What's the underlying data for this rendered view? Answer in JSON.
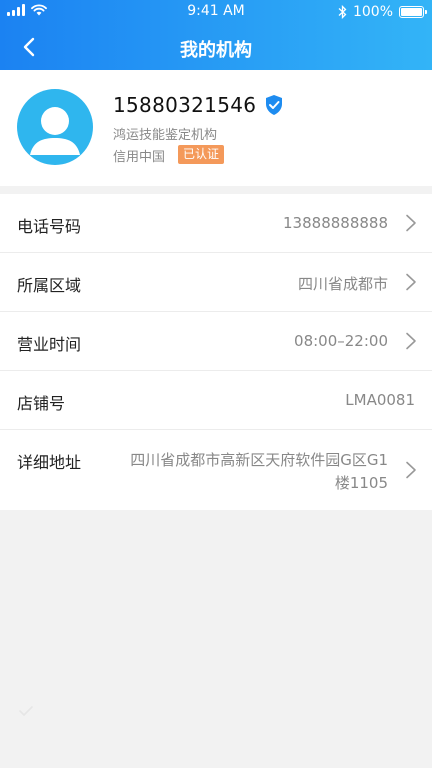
{
  "status_bar": {
    "time": "9:41 AM",
    "battery": "100%",
    "battery_level": 1.0
  },
  "nav": {
    "title": "我的机构",
    "back_icon": "chevron-left-icon"
  },
  "profile": {
    "phone": "15880321546",
    "org_name": "鸿运技能鉴定机构",
    "credit_label": "信用中国",
    "cert_badge": "已认证",
    "avatar_icon": "user-avatar-icon",
    "verify_icon": "shield-check-icon"
  },
  "info": {
    "phone_label": "电话号码",
    "phone_value": "13888888888",
    "region_label": "所属区域",
    "region_value": "四川省成都市",
    "hours_label": "营业时间",
    "hours_value": "08:00–22:00",
    "shop_label": "店铺号",
    "shop_value": "LMA0081",
    "address_label": "详细地址",
    "address_value": "四川省成都市高新区天府软件园G区G1楼1105"
  },
  "colors": {
    "header_start": "#1b82f2",
    "header_end": "#33b4f7",
    "avatar_bg": "#2fb6ee",
    "badge_bg": "#f4995a",
    "verify_blue": "#1e8cf0"
  }
}
